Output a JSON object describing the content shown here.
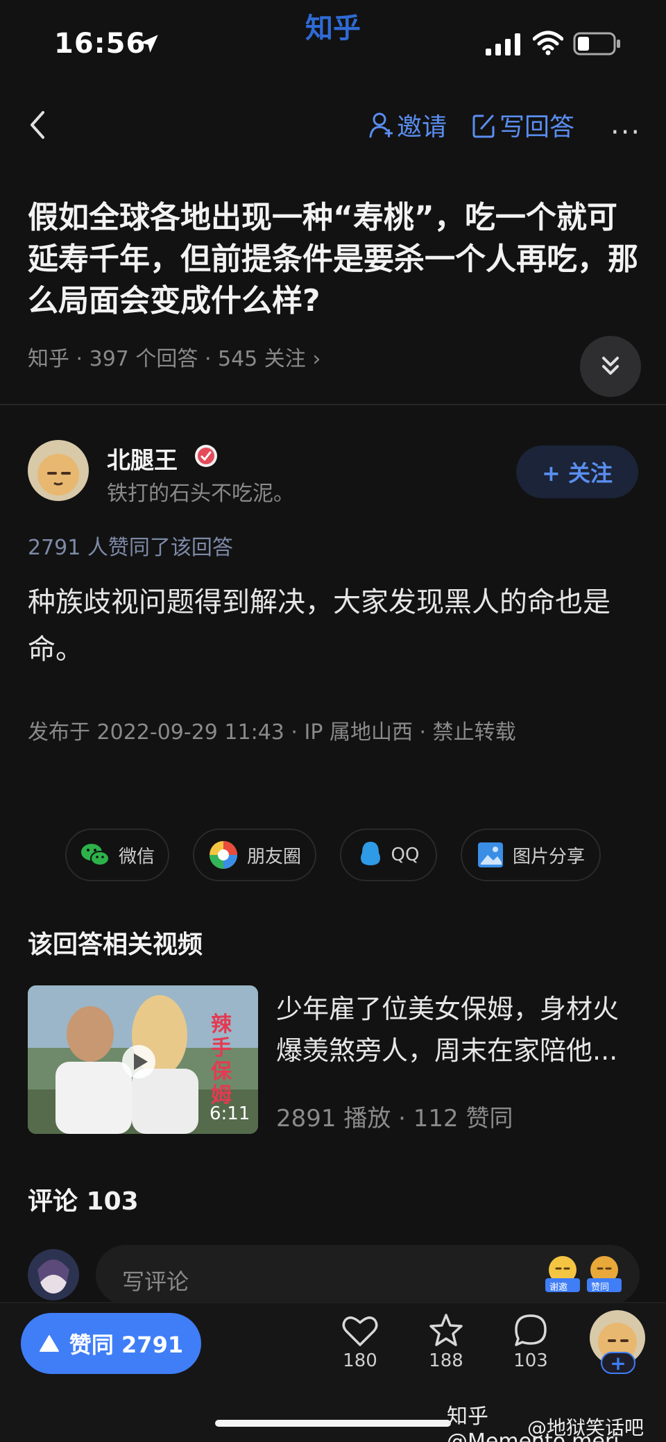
{
  "status_bar": {
    "time": "16:56",
    "app_name": "知乎"
  },
  "nav": {
    "invite_label": "邀请",
    "write_answer_label": "写回答",
    "more_label": "···"
  },
  "question": {
    "title": "假如全球各地出现一种“寿桃”，吃一个就可延寿千年，但前提条件是要杀一个人再吃，那么局面会变成什么样?",
    "meta": "知乎 · 397 个回答 · 545 关注 ›"
  },
  "author": {
    "name": "北腿王",
    "bio": "铁打的石头不吃泥。",
    "follow_label": "+ 关注"
  },
  "answer": {
    "votes_text": "2791 人赞同了该回答",
    "content": "种族歧视问题得到解决，大家发现黑人的命也是命。",
    "publish_info": "发布于 2022-09-29 11:43 · IP 属地山西 · 禁止转载"
  },
  "share": {
    "wechat": "微信",
    "moments": "朋友圈",
    "qq": "QQ",
    "image_share": "图片分享"
  },
  "related": {
    "section_title": "该回答相关视频",
    "video": {
      "title": "少年雇了位美女保姆，身材火爆羡煞旁人，周末在家陪他...",
      "overlay_text": "辣手保姆",
      "duration": "6:11",
      "meta": "2891 播放 · 112 赞同"
    }
  },
  "comments": {
    "section_title": "评论 103",
    "placeholder": "写评论",
    "emoji_1": "谢邀",
    "emoji_2": "赞同"
  },
  "bottom_bar": {
    "agree_label": "赞同 2791",
    "likes_count": "180",
    "favorites_count": "188",
    "comments_count": "103"
  },
  "watermark": {
    "line1": "知乎 @Memento.meri",
    "line2": "@地狱笑话吧"
  },
  "colors": {
    "accent": "#3f7ef7",
    "link_blue": "#5a8ef0",
    "background": "#121212"
  }
}
